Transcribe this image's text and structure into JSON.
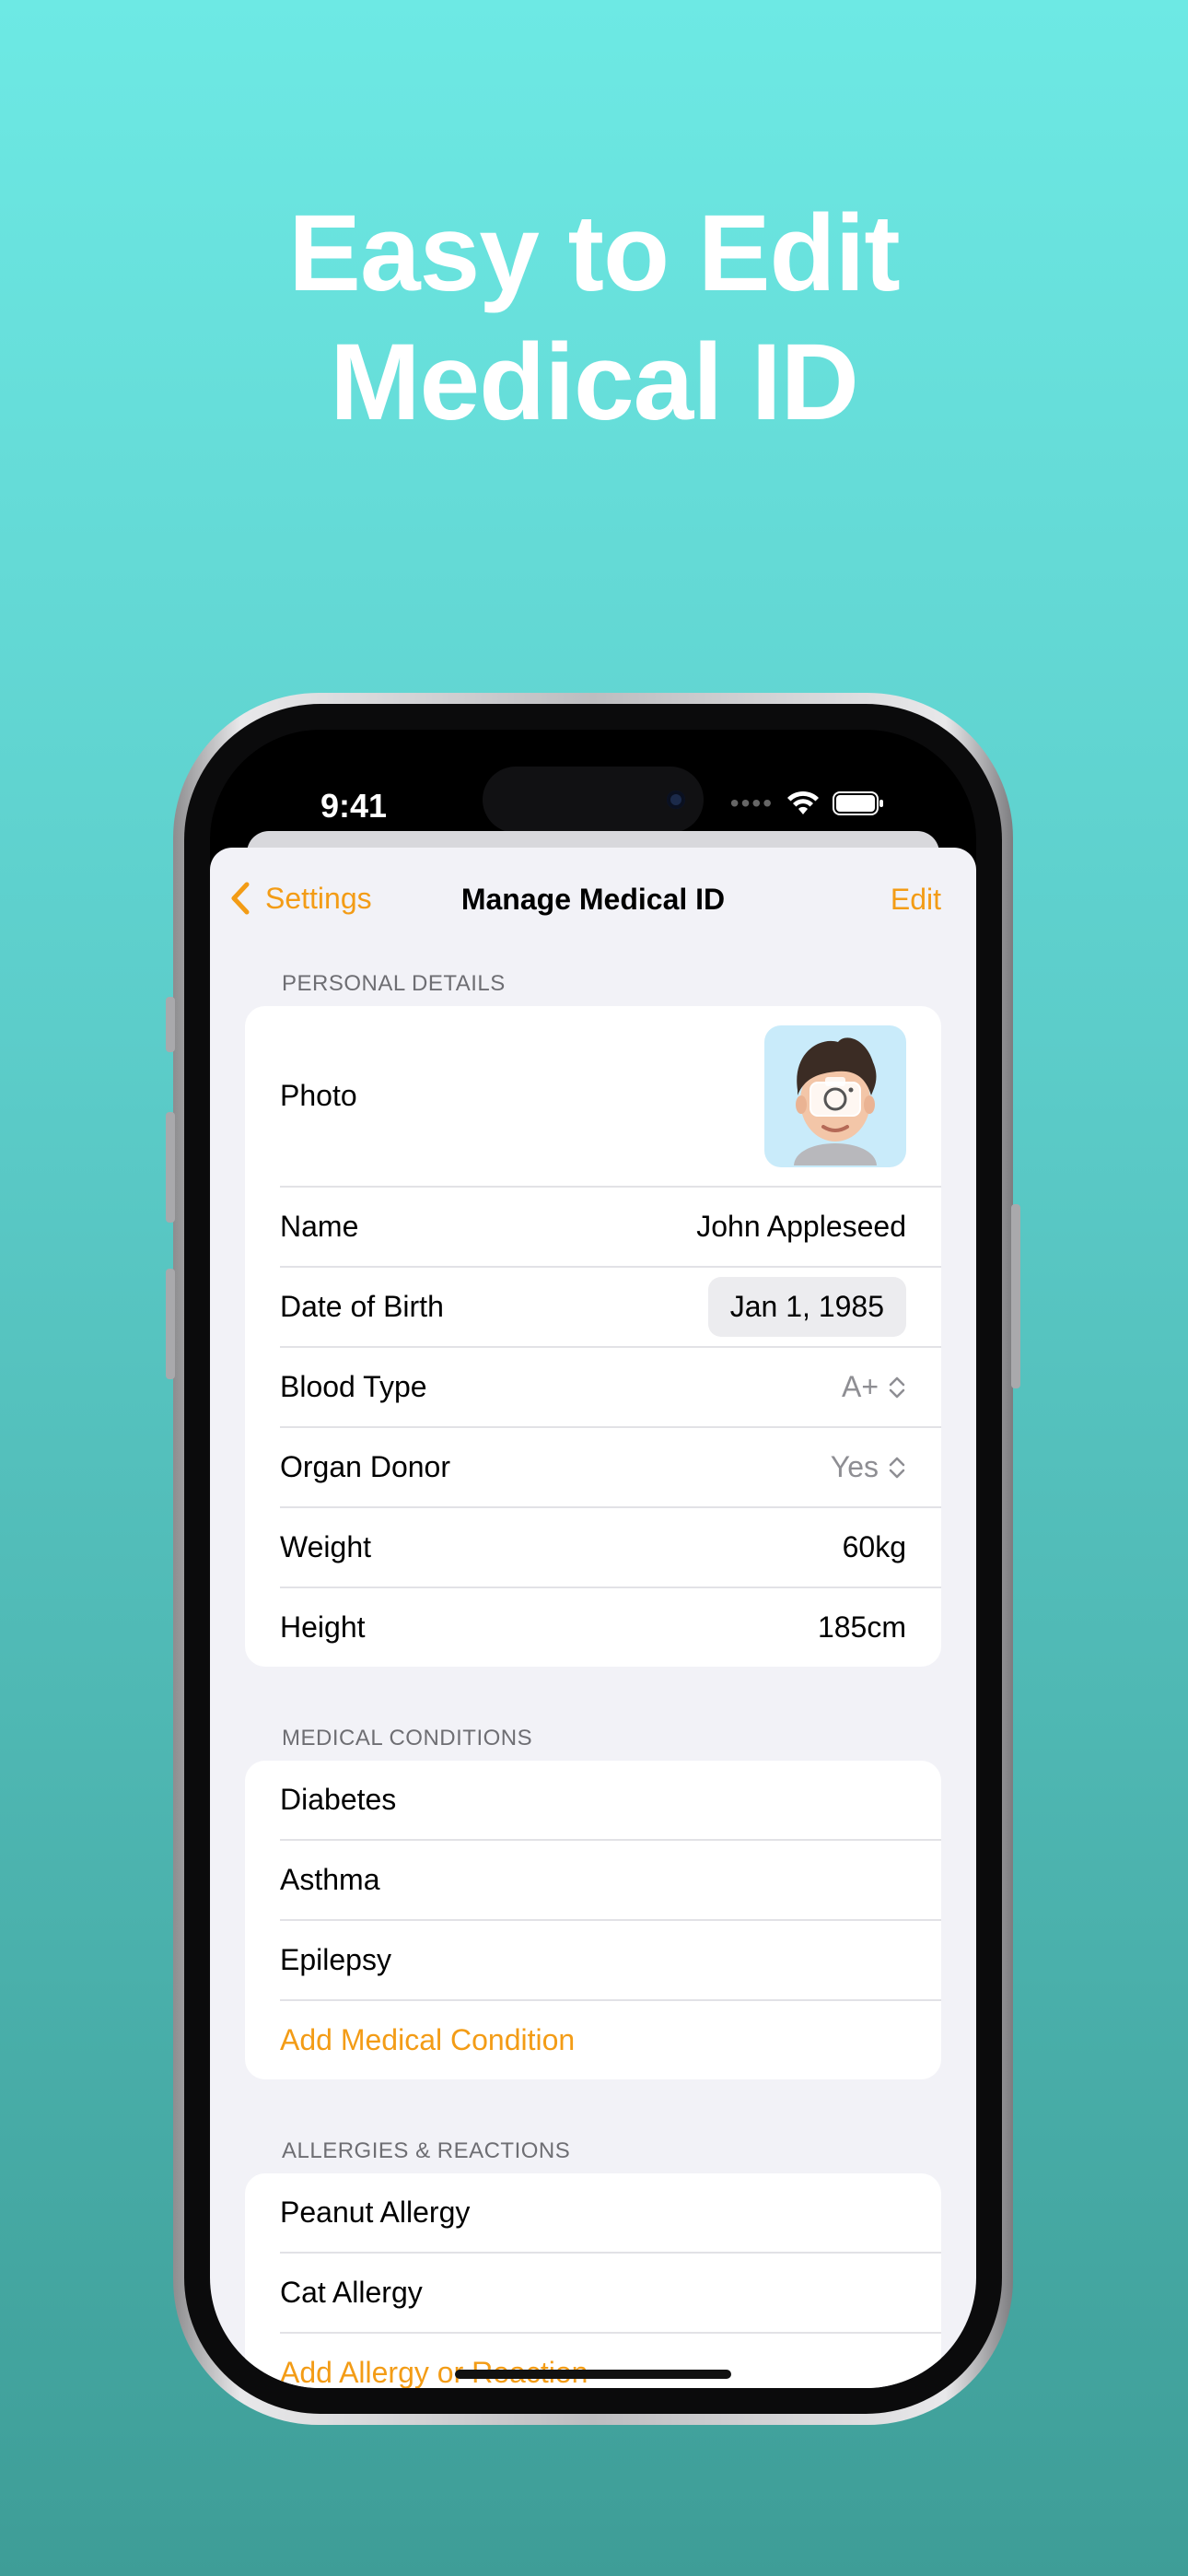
{
  "headline": [
    "Easy to Edit",
    "Medical ID"
  ],
  "status_bar": {
    "time": "9:41"
  },
  "nav": {
    "back_label": "Settings",
    "title": "Manage Medical ID",
    "edit_label": "Edit"
  },
  "personal": {
    "header": "PERSONAL DETAILS",
    "photo_label": "Photo",
    "rows": [
      {
        "label": "Name",
        "value": "John Appleseed"
      },
      {
        "label": "Date of Birth",
        "value": "Jan 1, 1985"
      },
      {
        "label": "Blood Type",
        "value": "A+"
      },
      {
        "label": "Organ Donor",
        "value": "Yes"
      },
      {
        "label": "Weight",
        "value": "60kg"
      },
      {
        "label": "Height",
        "value": "185cm"
      }
    ]
  },
  "conditions": {
    "header": "MEDICAL CONDITIONS",
    "items": [
      "Diabetes",
      "Asthma",
      "Epilepsy"
    ],
    "add_label": "Add Medical Condition"
  },
  "allergies": {
    "header": "ALLERGIES & REACTIONS",
    "items": [
      "Peanut Allergy",
      "Cat Allergy"
    ],
    "add_label": "Add Allergy or Reaction"
  },
  "colors": {
    "accent": "#f39c16",
    "background_top": "#6de9e4",
    "background_bottom": "#3e9d97"
  },
  "icons": [
    "chevron-left-icon",
    "camera-icon",
    "updown-chevron-icon",
    "wifi-icon",
    "battery-icon"
  ]
}
